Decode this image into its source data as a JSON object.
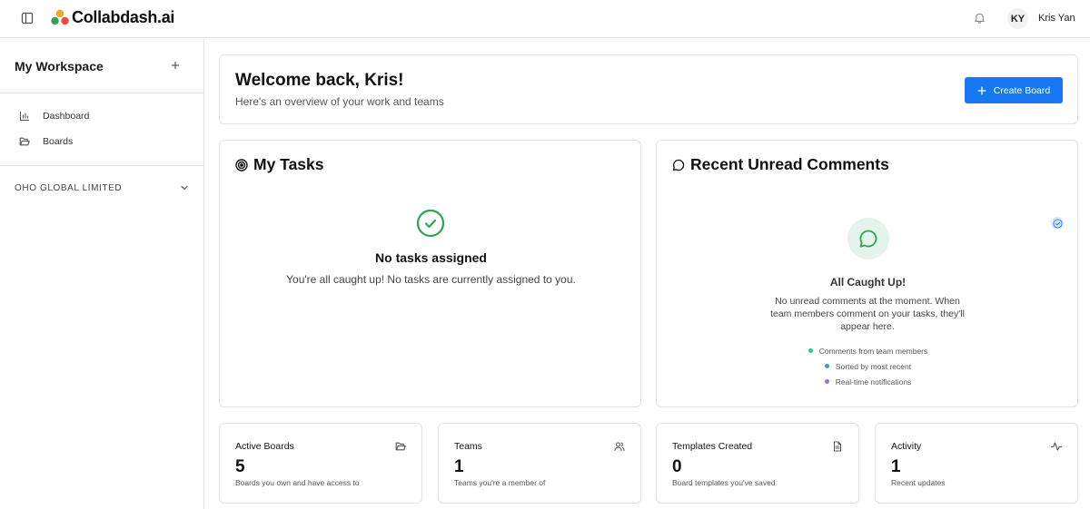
{
  "app": {
    "brand": "Collabdash.ai",
    "logo_colors": [
      "#2ea44f",
      "#f5a623",
      "#e74c3c"
    ]
  },
  "topbar": {
    "user_initials": "KY",
    "user_name": "Kris Yan",
    "notification_icon": "bell-icon",
    "sidebar_toggle_icon": "sidebar-panel-icon"
  },
  "sidebar": {
    "workspace_title": "My Workspace",
    "add_icon": "plus-icon",
    "items": [
      {
        "label": "Dashboard",
        "icon": "bar-chart-icon"
      },
      {
        "label": "Boards",
        "icon": "folder-open-icon"
      }
    ],
    "organization": "OHO GLOBAL LIMITED"
  },
  "welcome": {
    "title": "Welcome back, Kris!",
    "subtitle": "Here's an overview of your work and teams",
    "create_button": "Create Board"
  },
  "tasks": {
    "title": "My Tasks",
    "empty_title": "No tasks assigned",
    "empty_text": "You're all caught up! No tasks are currently assigned to you."
  },
  "comments": {
    "title": "Recent Unread Comments",
    "empty_title": "All Caught Up!",
    "empty_text": "No unread comments at the moment. When team members comment on your tasks, they'll appear here.",
    "bullets": [
      {
        "text": "Comments from team members",
        "color": "#34c77b"
      },
      {
        "text": "Sorted by most recent",
        "color": "#4a90e2"
      },
      {
        "text": "Real-time notifications",
        "color": "#a66bd8"
      }
    ]
  },
  "stats": [
    {
      "label": "Active Boards",
      "value": "5",
      "desc": "Boards you own and have access to",
      "icon": "folder-icon"
    },
    {
      "label": "Teams",
      "value": "1",
      "desc": "Teams you're a member of",
      "icon": "users-icon"
    },
    {
      "label": "Templates Created",
      "value": "0",
      "desc": "Board templates you've saved",
      "icon": "document-icon"
    },
    {
      "label": "Activity",
      "value": "1",
      "desc": "Recent updates",
      "icon": "activity-icon"
    }
  ],
  "colors": {
    "accent": "#1877f2",
    "success": "#2ea44f"
  }
}
